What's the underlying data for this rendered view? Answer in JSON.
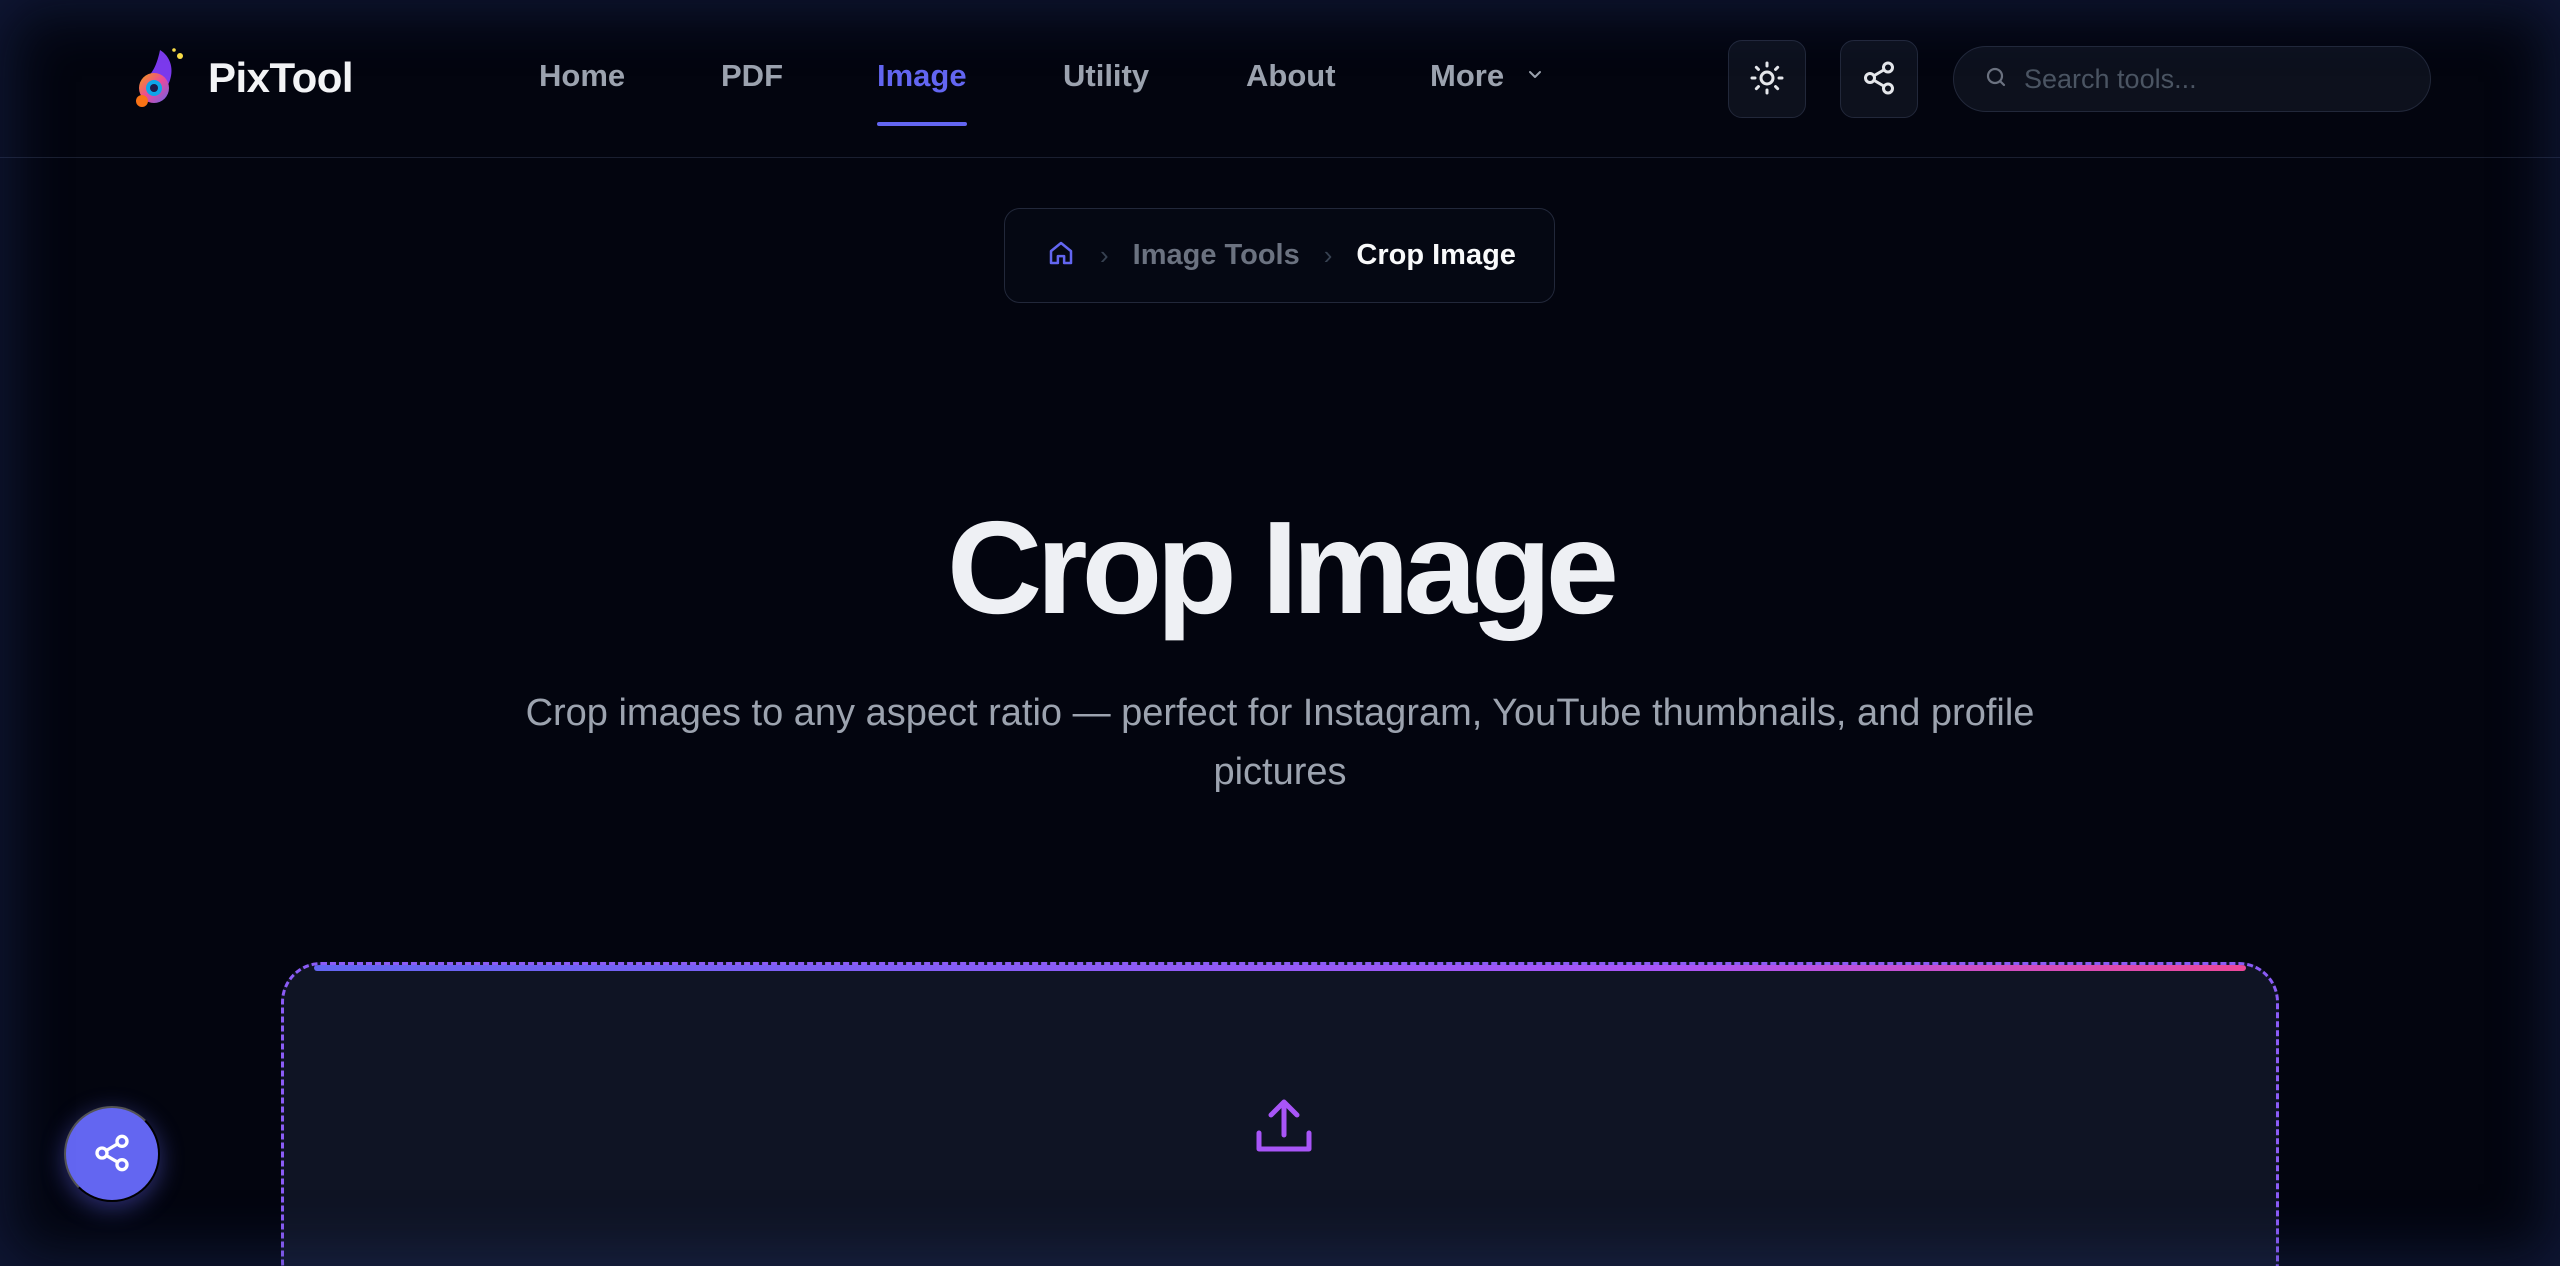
{
  "brand": {
    "name": "PixTool"
  },
  "nav": {
    "items": [
      {
        "label": "Home"
      },
      {
        "label": "PDF"
      },
      {
        "label": "Image"
      },
      {
        "label": "Utility"
      },
      {
        "label": "About"
      },
      {
        "label": "More"
      }
    ],
    "active_item": "Image"
  },
  "toolbar": {
    "theme_toggle_icon": "sun-icon",
    "share_icon": "share-icon"
  },
  "search": {
    "placeholder": "Search tools...",
    "value": ""
  },
  "breadcrumb": {
    "home_icon": "home-icon",
    "section": "Image Tools",
    "current": "Crop Image"
  },
  "hero": {
    "title": "Crop Image",
    "subtitle": "Crop images to any aspect ratio — perfect for Instagram, YouTube thumbnails, and profile pictures"
  },
  "upload": {
    "icon": "upload-icon"
  },
  "floating_share": {
    "icon": "share-icon"
  },
  "colors": {
    "accent": "#6366f1",
    "background": "#03050f",
    "upload_border": "#8b5cf6",
    "gradient_end": "#ec4899"
  }
}
